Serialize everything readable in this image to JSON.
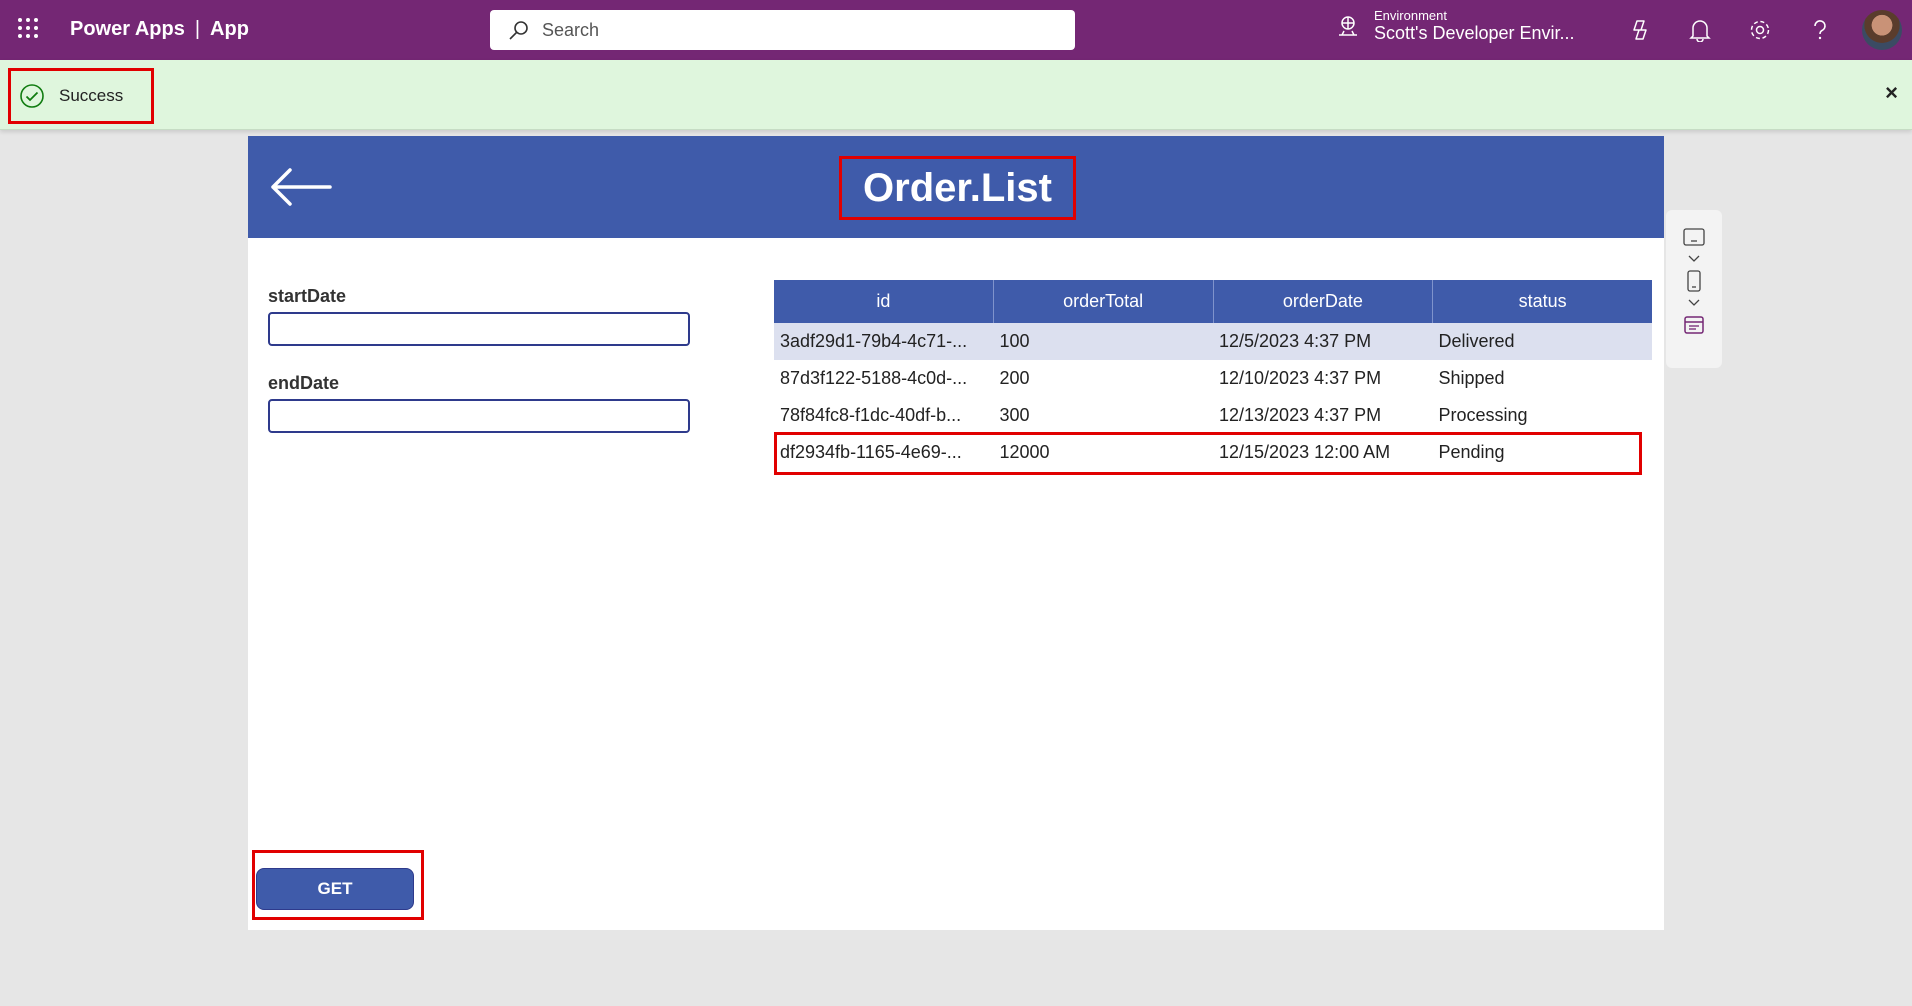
{
  "topbar": {
    "brand": "Power Apps",
    "separator": "|",
    "app": "App",
    "search_placeholder": "Search",
    "env_label": "Environment",
    "env_name": "Scott's Developer Envir..."
  },
  "notification": {
    "text": "Success",
    "close": "×"
  },
  "app": {
    "title": "Order.List",
    "start_label": "startDate",
    "end_label": "endDate",
    "get_label": "GET"
  },
  "grid": {
    "columns": [
      "id",
      "orderTotal",
      "orderDate",
      "status"
    ],
    "rows": [
      {
        "id": "3adf29d1-79b4-4c71-...",
        "orderTotal": "100",
        "orderDate": "12/5/2023 4:37 PM",
        "status": "Delivered"
      },
      {
        "id": "87d3f122-5188-4c0d-...",
        "orderTotal": "200",
        "orderDate": "12/10/2023 4:37 PM",
        "status": "Shipped"
      },
      {
        "id": "78f84fc8-f1dc-40df-b...",
        "orderTotal": "300",
        "orderDate": "12/13/2023 4:37 PM",
        "status": "Processing"
      },
      {
        "id": "df2934fb-1165-4e69-...",
        "orderTotal": "12000",
        "orderDate": "12/15/2023 12:00 AM",
        "status": "Pending"
      }
    ]
  },
  "colors": {
    "topbar": "#742774",
    "header": "#3f5baa",
    "success_bg": "#dff6dd",
    "highlight": "#e10000"
  },
  "icons": {
    "waffle": "waffle-icon",
    "search": "search-icon",
    "environment": "environment-icon",
    "copilot": "copilot-icon",
    "bell": "bell-icon",
    "gear": "gear-icon",
    "help": "help-icon",
    "success": "check-circle-icon",
    "back": "back-arrow-icon"
  }
}
